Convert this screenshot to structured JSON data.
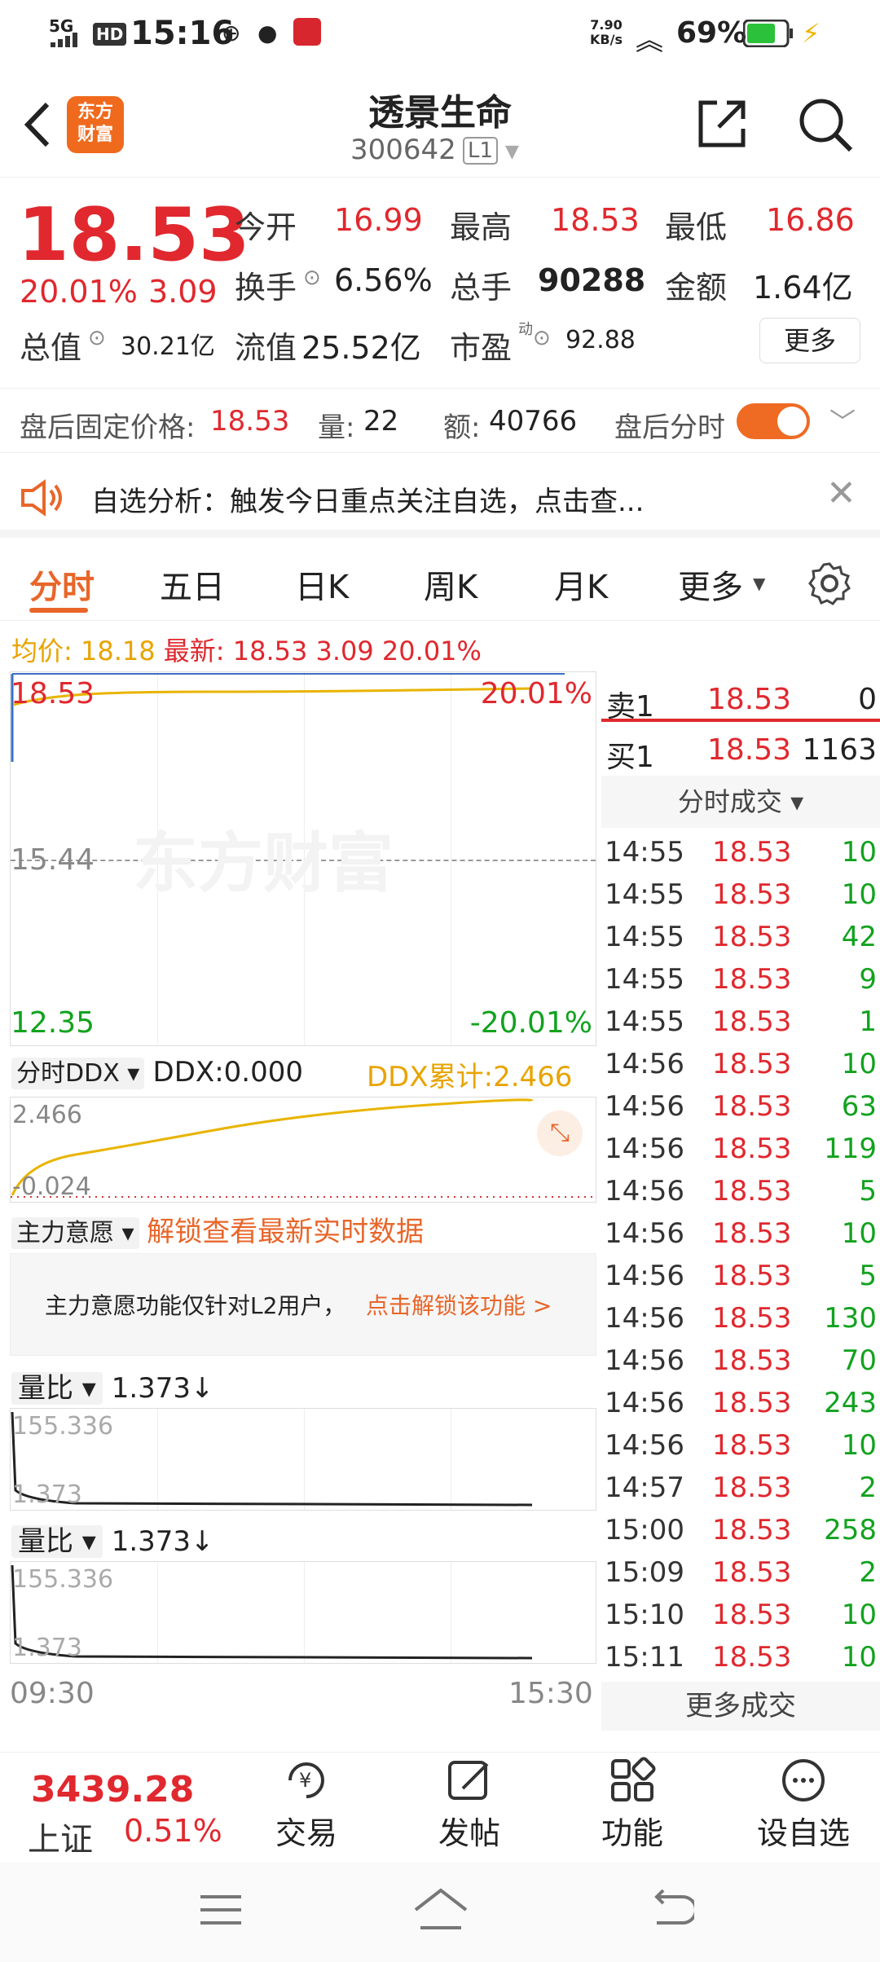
{
  "status": {
    "network": "5G",
    "hd": "HD",
    "time": "15:16",
    "speed_value": "7.90",
    "speed_unit": "KB/s",
    "battery": "69%"
  },
  "header": {
    "logo_line1": "东方",
    "logo_line2": "财富",
    "title": "透景生命",
    "code": "300642",
    "level": "L1"
  },
  "quote": {
    "price": "18.53",
    "change_pct": "20.01%",
    "change": "3.09",
    "open_label": "今开",
    "open": "16.99",
    "high_label": "最高",
    "high": "18.53",
    "low_label": "最低",
    "low": "16.86",
    "turnover_label": "换手",
    "turnover": "6.56%",
    "volume_label": "总手",
    "volume": "90288",
    "amount_label": "金额",
    "amount": "1.64亿",
    "mktcap_label": "总值",
    "mktcap": "30.21亿",
    "float_label": "流值",
    "float": "25.52亿",
    "pe_label": "市盈",
    "pe_sup": "动",
    "pe": "92.88",
    "more_label": "更多"
  },
  "afterhours": {
    "price_label": "盘后固定价格:",
    "price": "18.53",
    "vol_label": "量:",
    "vol": "22",
    "amt_label": "额:",
    "amt": "40766",
    "toggle_label": "盘后分时"
  },
  "notice": {
    "text": "自选分析：触发今日重点关注自选，点击查..."
  },
  "tabs": [
    {
      "label": "分时"
    },
    {
      "label": "五日"
    },
    {
      "label": "日K"
    },
    {
      "label": "周K"
    },
    {
      "label": "月K"
    },
    {
      "label": "更多"
    }
  ],
  "avg": {
    "avg_label": "均价:",
    "avg": "18.18",
    "latest_label": "最新:",
    "latest": "18.53",
    "change": "3.09",
    "pct": "20.01%"
  },
  "chart": {
    "top_price": "18.53",
    "top_pct": "20.01%",
    "mid_price": "15.44",
    "bottom_price": "12.35",
    "bottom_pct": "-20.01%",
    "watermark": "东方财富",
    "time_start": "09:30",
    "time_end": "15:30"
  },
  "ddx": {
    "selector": "分时DDX",
    "value": "DDX:0.000",
    "cum": "DDX累计:2.466",
    "top": "2.466",
    "bottom": "-0.024"
  },
  "main_force": {
    "selector": "主力意愿",
    "unlock": "解锁查看最新实时数据",
    "info": "主力意愿功能仅针对L2用户，",
    "info_link": "点击解锁该功能 >"
  },
  "volratio1": {
    "selector": "量比",
    "value": "1.373↓",
    "top": "155.336",
    "bottom": "1.373"
  },
  "volratio2": {
    "selector": "量比",
    "value": "1.373↓",
    "top": "155.336",
    "bottom": "1.373"
  },
  "book": {
    "sell1_label": "卖1",
    "sell1_price": "18.53",
    "sell1_vol": "0",
    "buy1_label": "买1",
    "buy1_price": "18.53",
    "buy1_vol": "1163",
    "trades_header": "分时成交",
    "trades": [
      {
        "t": "14:55",
        "p": "18.53",
        "v": "10"
      },
      {
        "t": "14:55",
        "p": "18.53",
        "v": "10"
      },
      {
        "t": "14:55",
        "p": "18.53",
        "v": "42"
      },
      {
        "t": "14:55",
        "p": "18.53",
        "v": "9"
      },
      {
        "t": "14:55",
        "p": "18.53",
        "v": "1"
      },
      {
        "t": "14:56",
        "p": "18.53",
        "v": "10"
      },
      {
        "t": "14:56",
        "p": "18.53",
        "v": "63"
      },
      {
        "t": "14:56",
        "p": "18.53",
        "v": "119"
      },
      {
        "t": "14:56",
        "p": "18.53",
        "v": "5"
      },
      {
        "t": "14:56",
        "p": "18.53",
        "v": "10"
      },
      {
        "t": "14:56",
        "p": "18.53",
        "v": "5"
      },
      {
        "t": "14:56",
        "p": "18.53",
        "v": "130"
      },
      {
        "t": "14:56",
        "p": "18.53",
        "v": "70"
      },
      {
        "t": "14:56",
        "p": "18.53",
        "v": "243"
      },
      {
        "t": "14:56",
        "p": "18.53",
        "v": "10"
      },
      {
        "t": "14:57",
        "p": "18.53",
        "v": "2"
      },
      {
        "t": "15:00",
        "p": "18.53",
        "v": "258"
      },
      {
        "t": "15:09",
        "p": "18.53",
        "v": "2"
      },
      {
        "t": "15:10",
        "p": "18.53",
        "v": "10"
      },
      {
        "t": "15:11",
        "p": "18.53",
        "v": "10"
      }
    ],
    "more_trades": "更多成交"
  },
  "bottom_nav": {
    "index_value": "3439.28",
    "index_name": "上证",
    "index_pct": "0.51%",
    "items": [
      {
        "label": "交易",
        "icon": "trade-icon"
      },
      {
        "label": "发帖",
        "icon": "post-icon"
      },
      {
        "label": "功能",
        "icon": "apps-icon"
      },
      {
        "label": "设自选",
        "icon": "add-watchlist-icon"
      }
    ]
  }
}
